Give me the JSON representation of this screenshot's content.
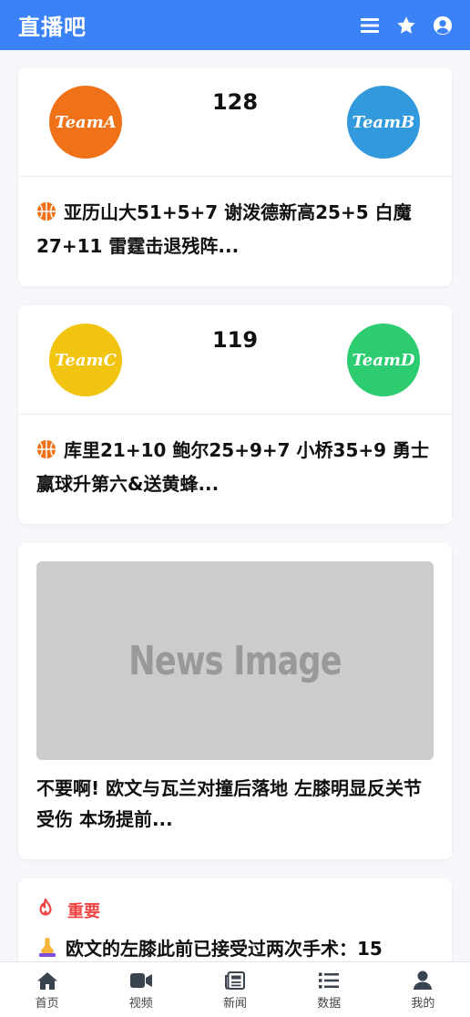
{
  "header": {
    "brand": "直播吧",
    "icons": [
      "menu-icon",
      "star-icon",
      "user-circle-icon"
    ]
  },
  "matches": [
    {
      "team_a": {
        "name": "TeamA",
        "color": "#f07218"
      },
      "team_b": {
        "name": "TeamB",
        "color": "#3399dd"
      },
      "score": "128",
      "headline": "亚历山大51+5+7 谢泼德新高25+5 白魔27+11 雷霆击退残阵..."
    },
    {
      "team_a": {
        "name": "TeamC",
        "color": "#f1c40f"
      },
      "team_b": {
        "name": "TeamD",
        "color": "#2ecc71"
      },
      "score": "119",
      "headline": "库里21+10 鲍尔25+9+7 小桥35+9 勇士赢球升第六&送黄蜂..."
    }
  ],
  "news": {
    "image_placeholder": "News Image",
    "title": "不要啊! 欧文与瓦兰对撞后落地 左膝明显反关节受伤 本场提前..."
  },
  "important": {
    "label": "重要",
    "text": "欧文的左膝此前已接受过两次手术：15"
  },
  "tabbar": [
    {
      "label": "首页",
      "icon": "home-icon"
    },
    {
      "label": "视频",
      "icon": "video-icon"
    },
    {
      "label": "新闻",
      "icon": "newspaper-icon"
    },
    {
      "label": "数据",
      "icon": "list-icon"
    },
    {
      "label": "我的",
      "icon": "user-icon"
    }
  ],
  "colors": {
    "primary": "#3b82f6",
    "important": "#ef4444"
  }
}
